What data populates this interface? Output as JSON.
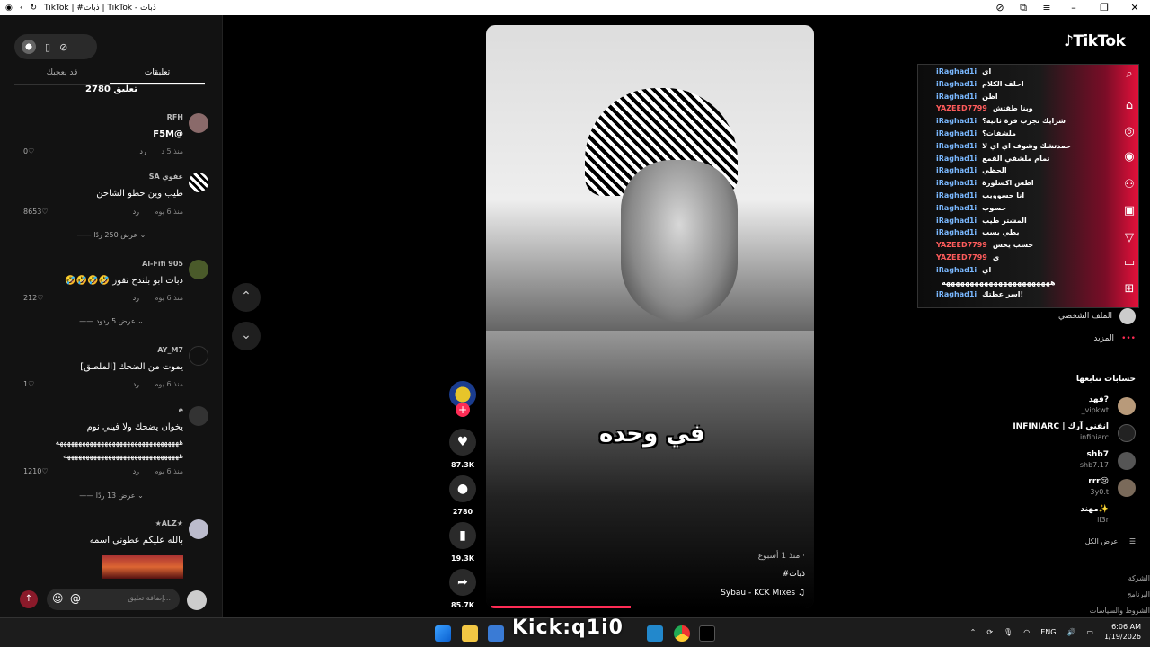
{
  "window": {
    "title": "TikTok | #ذبات | TikTok - ذبات"
  },
  "comments_panel": {
    "tabs": [
      "قد يعجبك",
      "تعليقات"
    ],
    "count_label": "2780 تعليق",
    "comments": [
      {
        "user": "RFH",
        "text": "@F5M",
        "time": "منذ 5 د",
        "reply": "رد",
        "likes": "0"
      },
      {
        "user": "عفوي SA",
        "text": "طيب وين حطو الشاحن",
        "time": "منذ 6 يوم",
        "reply": "رد",
        "likes": "8653",
        "replies": "عرض 250 ردًا"
      },
      {
        "user": "Al-Fifi 905",
        "text": "ذبات ابو بلندح تفوز 🤣🤣🤣🤣",
        "time": "منذ 6 يوم",
        "reply": "رد",
        "likes": "212",
        "replies": "عرض 5 ردود"
      },
      {
        "user": "AY_M7",
        "text": "يموت من الضحك [الملصق]",
        "time": "منذ 6 يوم",
        "reply": "رد",
        "likes": "1"
      },
      {
        "user": "e",
        "text": "يخوان يضحك ولا فيني نوم",
        "text2": "هههههههههههههههههههههههههههههههههه",
        "text3": "هههههههههههههههههههههههههههههههه",
        "time": "منذ 6 يوم",
        "reply": "رد",
        "likes": "1210",
        "replies": "عرض 13 ردًا"
      },
      {
        "user": "★ALZ★",
        "text": "بالله عليكم عطوني اسمه"
      }
    ],
    "input_placeholder": "إضافة تعليق..."
  },
  "video": {
    "caption_overlay": "في وحده",
    "meta": "· منذ 1 أسبوع",
    "hashtag": "#ذبات",
    "music": "Sybau - KCK Mixes ♫"
  },
  "actions": {
    "likes": "87.3K",
    "comments": "2780",
    "saves": "19.3K",
    "shares": "85.7K"
  },
  "right_panel": {
    "logo": "TikTok",
    "chat": [
      {
        "user": "iRaghad1i",
        "msg": "اي"
      },
      {
        "user": "iRaghad1i",
        "msg": "احلف الكلام"
      },
      {
        "user": "iRaghad1i",
        "msg": "اظن"
      },
      {
        "user": "YAZEED7799",
        "msg": "وبنا طقتش"
      },
      {
        "user": "iRaghad1i",
        "msg": "شرايك تجرب فرة ثانية؟"
      },
      {
        "user": "iRaghad1i",
        "msg": "ملشفات؟"
      },
      {
        "user": "iRaghad1i",
        "msg": "حمدتشك وشوف اي اي لا"
      },
      {
        "user": "iRaghad1i",
        "msg": "تمام ملشفي القمع"
      },
      {
        "user": "iRaghad1i",
        "msg": "الحظي"
      },
      {
        "user": "iRaghad1i",
        "msg": "اطس اكسلورة"
      },
      {
        "user": "iRaghad1i",
        "msg": "انا حسوويب"
      },
      {
        "user": "iRaghad1i",
        "msg": "حسوب"
      },
      {
        "user": "iRaghad1i",
        "msg": "المشتر طيب"
      },
      {
        "user": "iRaghad1i",
        "msg": "يطي يسب"
      },
      {
        "user": "YAZEED7799",
        "msg": "حسب يحس"
      },
      {
        "user": "YAZEED7799",
        "msg": "ي"
      },
      {
        "user": "iRaghad1i",
        "msg": "اي"
      },
      {
        "user": "",
        "msg": "هههههههههههههههههههههههه"
      },
      {
        "user": "iRaghad1i",
        "msg": "اسر عطتك!"
      }
    ],
    "menu": [
      {
        "label": "الملف الشخصي"
      },
      {
        "label": "المزيد"
      }
    ],
    "following_heading": "حسابات تتابعها",
    "accounts": [
      {
        "name": "فهد?",
        "handle": "_vipkwt"
      },
      {
        "name": "INFINIARC | انفني آرك",
        "handle": "infiniarc"
      },
      {
        "name": "shb7",
        "handle": "shb7.17"
      },
      {
        "name": "rrr😢",
        "handle": "3y0.t"
      },
      {
        "name": "مهند✨",
        "handle": "ll3r"
      }
    ],
    "see_all": "عرض الكل",
    "footer": [
      "الشركة",
      "البرنامج",
      "الشروط والسياسات"
    ]
  },
  "taskbar": {
    "watermark": "Kick:q1i0",
    "lang": "ENG",
    "time": "6:06 AM",
    "date": "1/19/2026"
  }
}
